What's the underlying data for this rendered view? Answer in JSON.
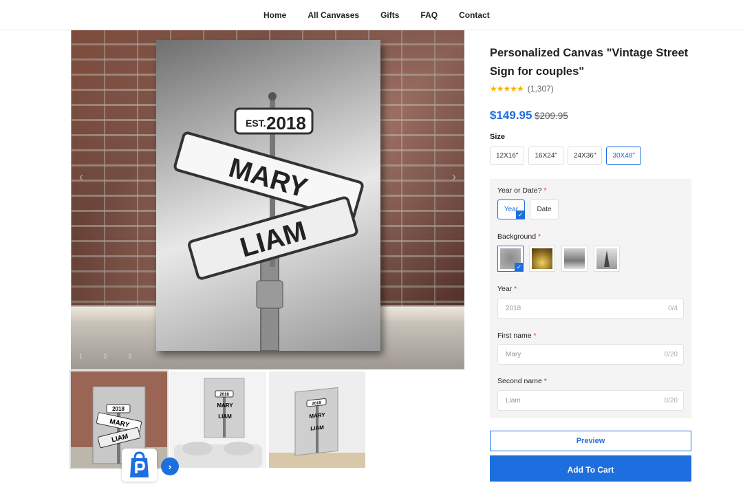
{
  "nav": {
    "items": [
      "Home",
      "All Canvases",
      "Gifts",
      "FAQ",
      "Contact"
    ]
  },
  "product_image": {
    "sign_year": "2018",
    "sign_est": "EST.",
    "sign_name_1": "MARY",
    "sign_name_2": "LIAM",
    "prev_arrow": "‹",
    "next_arrow": "›",
    "dots": "1 2 3"
  },
  "thumbnails": [
    {
      "year": "2018",
      "name_1": "MARY",
      "name_2": "LIAM"
    },
    {
      "year": "2018",
      "name_1": "MARY",
      "name_2": "LIAM"
    },
    {
      "year": "2018",
      "name_1": "MARY",
      "name_2": "LIAM"
    }
  ],
  "product": {
    "title": "Personalized Canvas \"Vintage Street Sign for couples\"",
    "stars": "★★★★★",
    "review_count": "(1,307)",
    "price": "$149.95",
    "old_price": "$209.95",
    "size_label": "Size",
    "sizes": [
      "12X16\"",
      "16X24\"",
      "24X36\"",
      "30X48\""
    ],
    "selected_size": "30X48\""
  },
  "options": {
    "year_or_date_label": "Year or Date?",
    "year_or_date_choices": [
      "Year",
      "Date"
    ],
    "background_label": "Background",
    "year_label": "Year",
    "year_value": "2018",
    "year_count": "0/4",
    "first_name_label": "First name",
    "first_name_value": "Mary",
    "first_name_count": "0/20",
    "second_name_label": "Second name",
    "second_name_value": "Liam",
    "second_name_count": "0/20",
    "required_mark": "*",
    "check": "✓"
  },
  "buttons": {
    "preview": "Preview",
    "add_to_cart": "Add To Cart",
    "next": "›"
  },
  "colors": {
    "accent": "#1d6fe0",
    "star": "#f5b301",
    "required": "#dd3333"
  }
}
